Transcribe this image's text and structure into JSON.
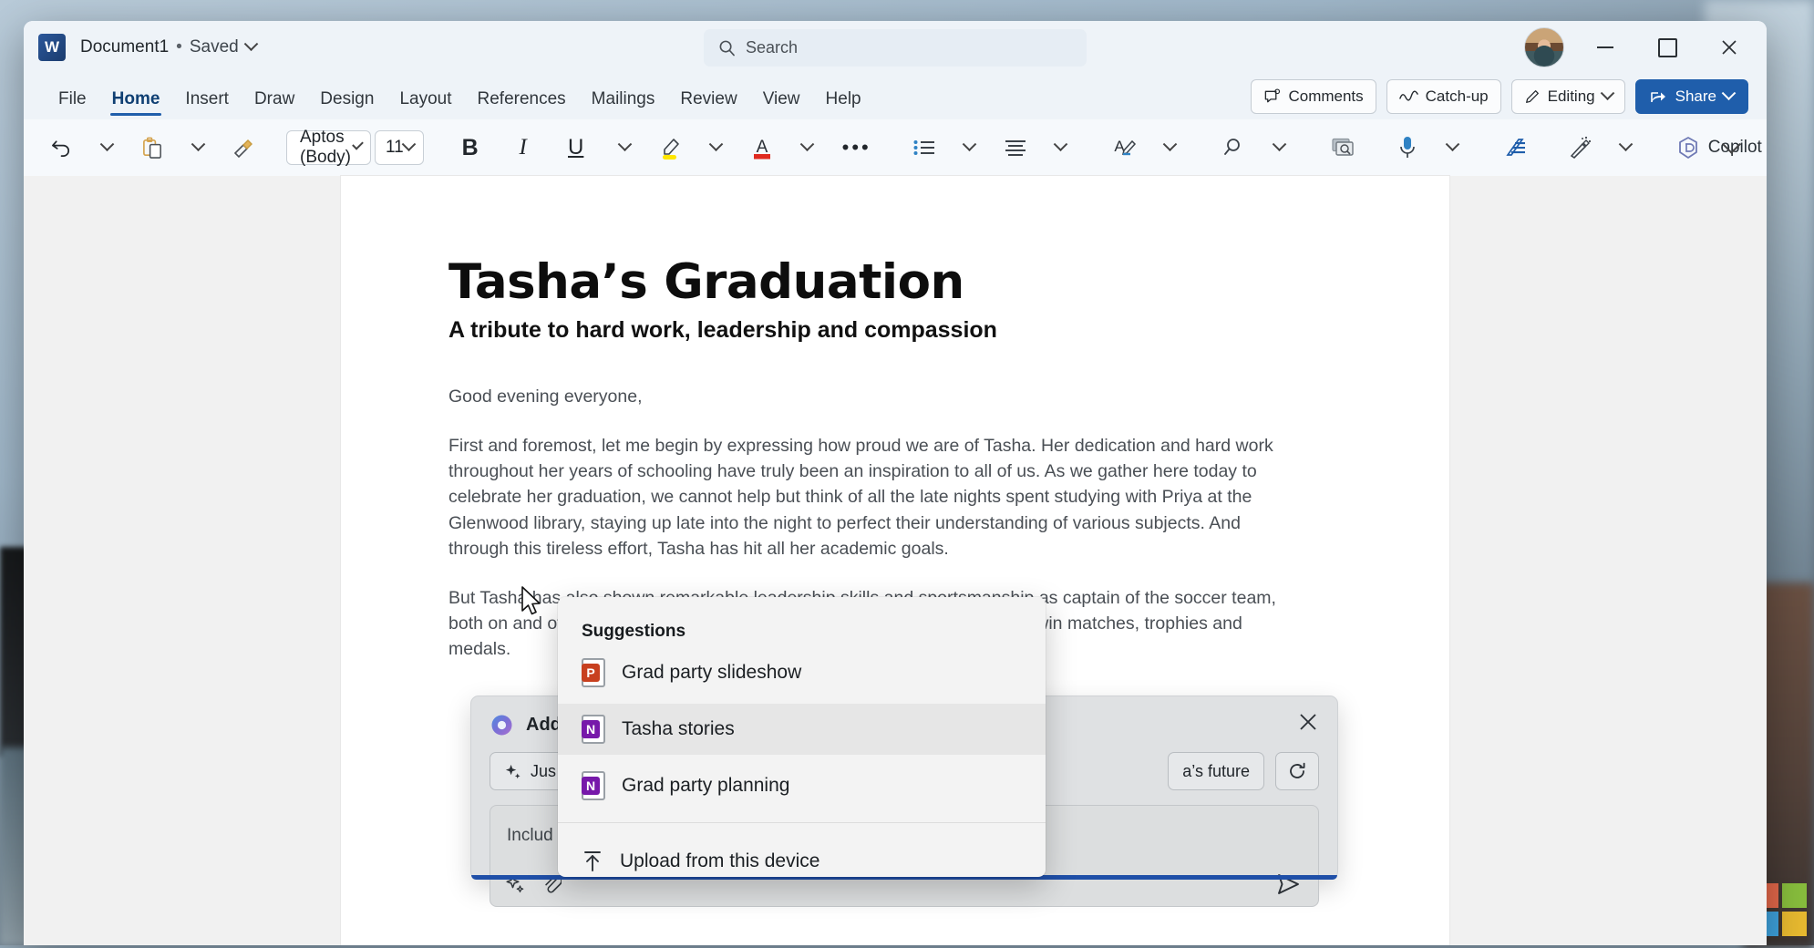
{
  "window": {
    "app_icon": "word-icon",
    "document_name": "Document1",
    "separator": "•",
    "save_state": "Saved",
    "minimize": "minimize-icon",
    "maximize": "maximize-icon",
    "close": "close-icon"
  },
  "search": {
    "placeholder": "Search",
    "icon": "search-icon"
  },
  "ribbon": {
    "tabs": [
      {
        "label": "File",
        "active": false
      },
      {
        "label": "Home",
        "active": true
      },
      {
        "label": "Insert",
        "active": false
      },
      {
        "label": "Draw",
        "active": false
      },
      {
        "label": "Design",
        "active": false
      },
      {
        "label": "Layout",
        "active": false
      },
      {
        "label": "References",
        "active": false
      },
      {
        "label": "Mailings",
        "active": false
      },
      {
        "label": "Review",
        "active": false
      },
      {
        "label": "View",
        "active": false
      },
      {
        "label": "Help",
        "active": false
      }
    ],
    "actions": {
      "comments": "Comments",
      "catchup": "Catch-up",
      "editing": "Editing",
      "share": "Share"
    }
  },
  "toolbar": {
    "undo": "undo-icon",
    "paste": "paste-icon",
    "format_painter": "format-painter-icon",
    "font_family": "Aptos (Body)",
    "font_size": "11",
    "bold": "B",
    "italic": "I",
    "underline": "U",
    "highlight": "text-highlight-icon",
    "font_color": "A",
    "more_formatting": "•••",
    "bullets": "bullet-list-icon",
    "align": "align-icon",
    "styles": "styles-icon",
    "find": "find-icon",
    "screenshot": "screen-capture-icon",
    "dictate": "microphone-icon",
    "editor": "editor-icon",
    "designer": "designer-icon",
    "copilot": "Copilot",
    "addins": "add-ins-icon",
    "overflow": "•••",
    "collapse_ribbon": "chevron-down-icon"
  },
  "document": {
    "title": "Tasha’s Graduation",
    "subtitle": "A tribute to hard work, leadership and compassion",
    "paragraphs": [
      "Good evening everyone,",
      "First and foremost, let me begin by expressing how proud we are of Tasha. Her dedication and hard work throughout her years of schooling have truly been an inspiration to all of us. As we gather here today to celebrate her graduation, we cannot help but think of all the late nights spent studying with Priya at the Glenwood library, staying up late into the night to perfect their understanding of various subjects. And through this tireless effort, Tasha has hit all her academic goals.",
      "But Tasha has also shown remarkable leadership skills and sportsmanship as captain of the soccer team, both on and off the field. This role enabled her to inspire her teammates to win matches, trophies and medals."
    ]
  },
  "copilot_card": {
    "header_label": "Add",
    "header_icon": "copilot-icon",
    "close": "close-icon",
    "chip_prompt": "Jus",
    "chip_prompt_icon": "sparkle-icon",
    "chip_prompt_tail": "a’s future",
    "refresh": "refresh-icon",
    "input_placeholder": "Includ",
    "sparkle": "sparkle-icon",
    "attach": "paperclip-icon",
    "send": "send-icon"
  },
  "suggestions_flyout": {
    "title": "Suggestions",
    "items": [
      {
        "label": "Grad party slideshow",
        "icon": "powerpoint-file-icon",
        "badge": "P",
        "selected": false
      },
      {
        "label": "Tasha stories",
        "icon": "onenote-file-icon",
        "badge": "N",
        "selected": true
      },
      {
        "label": "Grad party planning",
        "icon": "onenote-file-icon",
        "badge": "N",
        "selected": false
      }
    ],
    "upload": {
      "label": "Upload from this device",
      "icon": "upload-icon"
    }
  },
  "desktop": {
    "watermark": "microsoft-logo"
  },
  "colors": {
    "accent": "#1f5eab",
    "share_bg": "#1f5eab",
    "highlight_yellow": "#ffe600",
    "font_color_red": "#e02b20",
    "titlebar_bg": "#eef3f8",
    "flyout_bg": "#f3f3f3",
    "copilot_card_bg": "#dfe1e3"
  }
}
